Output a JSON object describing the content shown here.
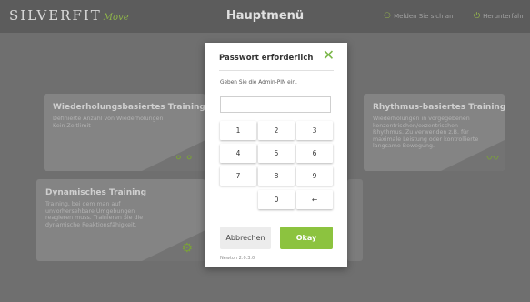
{
  "header": {
    "logo_text": "SILVERFIT",
    "logo_tagline": "Move",
    "title": "Hauptmenü",
    "login_label": "Melden Sie sich an",
    "shutdown_label": "Herunterfahr"
  },
  "cards": [
    {
      "title": "Wiederholungsbasiertes Training",
      "description": "Definierte Anzahl von Wiederholungen\nKein Zeitlimit"
    },
    {
      "title": "Rhythmus-basiertes Training",
      "description": "Wiederholungen in vorgegebenen\nkonzentrischen/exzentrischen\nRhythmus. Zu verwenden z.B. für\nmaximale Leistung oder kontrollierte\nlangsame Bewegung."
    },
    {
      "title": "Dynamisches Training",
      "description": "Training, bei dem man auf\nunvorhersehbare Umgebungen\nreagieren muss. Trainieren Sie die\ndynamische Reaktionsfähigkeit."
    }
  ],
  "dialog": {
    "title": "Passwort erforderlich",
    "message": "Geben Sie die Admin-PIN ein.",
    "pin_value": "",
    "keys": [
      "1",
      "2",
      "3",
      "4",
      "5",
      "6",
      "7",
      "8",
      "9",
      "0",
      "←"
    ],
    "cancel_label": "Abbrechen",
    "ok_label": "Okay",
    "version": "Newton 2.0.3.0"
  },
  "colors": {
    "accent": "#8cc33f",
    "topbar": "#5c5c5c",
    "background": "#6f6f6f"
  }
}
